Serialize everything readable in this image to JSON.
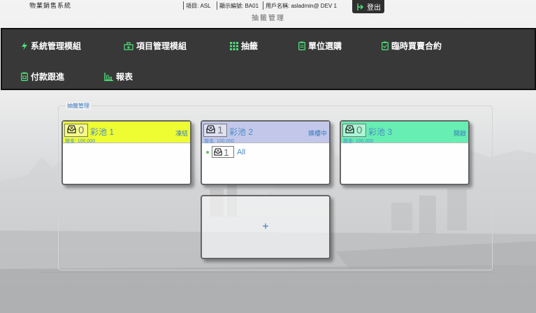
{
  "header": {
    "app_name": "物業銷售系統",
    "project": "項目: ASL",
    "display_id": "顯示編號: BA01",
    "user": "用戶名稱: asladmin@ DEV 1",
    "page_heading": "抽籤管理",
    "logout_label": "登出"
  },
  "menu": {
    "items": [
      {
        "label": "系統管理模組",
        "icon": "bolt-icon"
      },
      {
        "label": "項目管理模組",
        "icon": "building-plus-icon"
      },
      {
        "label": "抽籤",
        "icon": "grid-icon"
      },
      {
        "label": "單位選購",
        "icon": "clipboard-icon"
      },
      {
        "label": "臨時買賣合約",
        "icon": "clipboard-check-icon"
      },
      {
        "label": "付款跟進",
        "icon": "clipboard-money-icon"
      },
      {
        "label": "報表",
        "icon": "bar-chart-icon"
      }
    ]
  },
  "panel": {
    "title": "抽籤管理"
  },
  "pools": [
    {
      "count": "0",
      "name": "彩池 1",
      "status": "凍結",
      "sub": "按金: 100,000",
      "color": "#eefc32",
      "rows": []
    },
    {
      "count": "1",
      "name": "彩池 2",
      "status": "揀樓中",
      "sub": "按金: 100,000",
      "color": "#c3c8ea",
      "rows": [
        {
          "count": "1",
          "label": "All"
        }
      ]
    },
    {
      "count": "0",
      "name": "彩池 3",
      "status": "開啟",
      "sub": "按金: 100,000",
      "color": "#67eeb2",
      "rows": []
    }
  ],
  "add_label": "+",
  "colors": {
    "menu_bg": "#383838",
    "accent_green": "#4ee07a",
    "link_blue": "#3a7abf"
  }
}
